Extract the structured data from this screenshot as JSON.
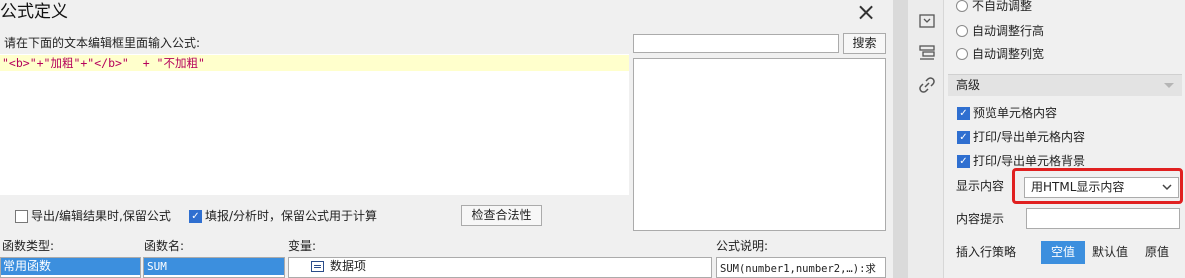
{
  "dialog": {
    "title": "公式定义",
    "instruction": "请在下面的文本编辑框里面输入公式:",
    "formula": "\"<b>\"+\"加粗\"+\"</b>\"  + \"不加粗\"",
    "search_placeholder": "",
    "search_button": "搜索",
    "option_export_keep": "导出/编辑结果时,保留公式",
    "option_fill_keep": "填报/分析时，保留公式用于计算",
    "option_export_keep_checked": false,
    "option_fill_keep_checked": true,
    "check_button": "检查合法性",
    "columns": {
      "function_type": "函数类型:",
      "function_name": "函数名:",
      "variable": "变量:",
      "description": "公式说明:"
    },
    "function_type_selected": "常用函数",
    "function_name_selected": "SUM",
    "variable_item": "数据项",
    "description_text": "SUM(number1,number2,…):求"
  },
  "panel": {
    "radios": [
      "不自动调整",
      "自动调整行高",
      "自动调整列宽"
    ],
    "advanced_header": "高级",
    "checkboxes": [
      {
        "label": "预览单元格内容",
        "checked": true
      },
      {
        "label": "打印/导出单元格内容",
        "checked": true
      },
      {
        "label": "打印/导出单元格背景",
        "checked": true
      }
    ],
    "show_content_label": "显示内容",
    "show_content_value": "用HTML显示内容",
    "content_tip_label": "内容提示",
    "insert_policy_label": "插入行策略",
    "insert_policy_options": [
      "空值",
      "默认值",
      "原值"
    ],
    "insert_policy_selected": "空值"
  },
  "colors": {
    "selection": "#3c8fde",
    "highlight_border": "#e02020",
    "editor_line": "#ffffcc",
    "formula_text": "#b5005b"
  },
  "icons": [
    "close-icon",
    "frame-icon",
    "layout-icon",
    "link-icon",
    "chevron-down-icon",
    "checkmark-icon",
    "list-icon"
  ]
}
